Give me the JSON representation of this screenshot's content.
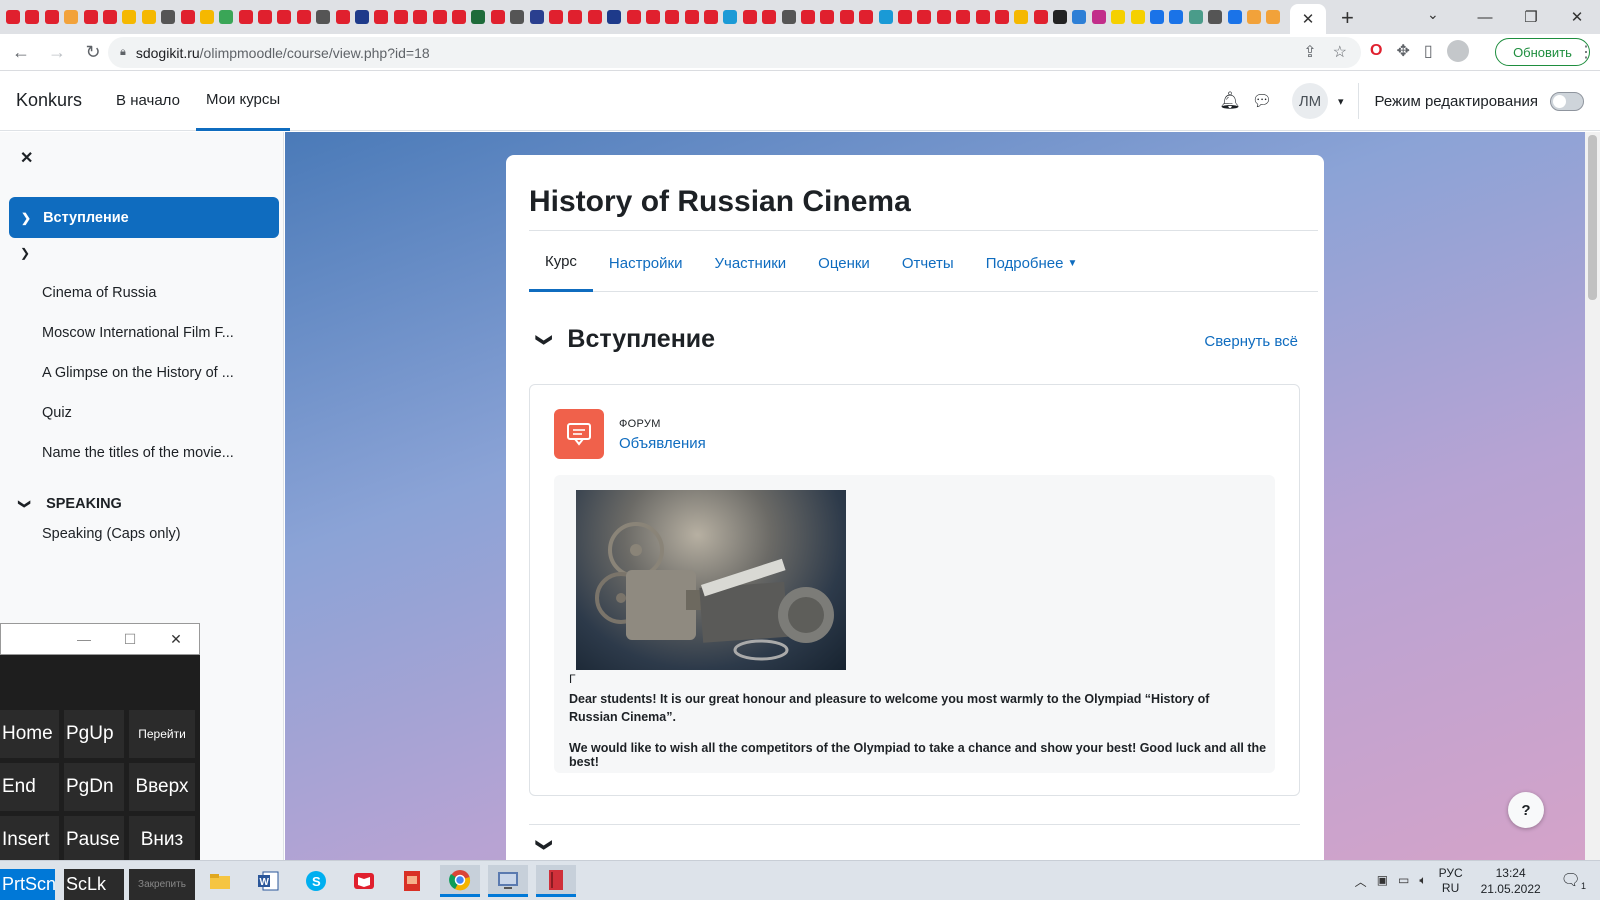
{
  "browser": {
    "url_host": "sdogikit.ru",
    "url_path": "/olimpmoodle/course/view.php?id=18",
    "update_label": "Обновить",
    "favicon_colors": [
      "#e0202e",
      "#e0202e",
      "#e0202e",
      "#f2a23a",
      "#e0202e",
      "#e0202e",
      "#f5b800",
      "#f5b800",
      "#555",
      "#e0202e",
      "#f5b800",
      "#3aa657",
      "#e0202e",
      "#e0202e",
      "#e0202e",
      "#e0202e",
      "#555",
      "#e0202e",
      "#1e3a8a",
      "#e0202e",
      "#e0202e",
      "#e0202e",
      "#e0202e",
      "#e0202e",
      "#1e6b3a",
      "#e0202e",
      "#555",
      "#2a3f8f",
      "#e0202e",
      "#e0202e",
      "#e0202e",
      "#1e3a8a",
      "#e0202e",
      "#e0202e",
      "#e0202e",
      "#e0202e",
      "#e0202e",
      "#1a9ad6",
      "#e0202e",
      "#e0202e",
      "#555",
      "#e0202e",
      "#e0202e",
      "#e0202e",
      "#e0202e",
      "#1a9ad6",
      "#e0202e",
      "#e0202e",
      "#e0202e",
      "#e0202e",
      "#e0202e",
      "#e0202e",
      "#f5b800",
      "#e0202e",
      "#222",
      "#2d7fd6",
      "#c22d8a",
      "#f5d000",
      "#f5d000",
      "#1a73e8",
      "#1a73e8",
      "#4a9c8a",
      "#555",
      "#1a73e8",
      "#f2a23a",
      "#f2a23a"
    ]
  },
  "navbar": {
    "brand": "Konkurs",
    "home": "В начало",
    "my_courses": "Мои курсы",
    "user_initials": "ЛМ",
    "edit_mode": "Режим редактирования"
  },
  "drawer": {
    "active_section": "Вступление",
    "items": [
      "Cinema of Russia",
      "Moscow International Film F...",
      "A Glimpse on the History of ...",
      "Quiz",
      "Name the titles of the movie..."
    ],
    "speaking_section": "SPEAKING",
    "speaking_item": "Speaking (Caps only)"
  },
  "course": {
    "title": "History of Russian Cinema",
    "tabs": [
      "Курс",
      "Настройки",
      "Участники",
      "Оценки",
      "Отчеты",
      "Подробнее"
    ],
    "section_title": "Вступление",
    "collapse_all": "Свернуть всё",
    "activity_type": "Форум",
    "activity_name": "Объявления",
    "stray_char": "Г",
    "paragraph1": "Dear students!  It is our great honour and pleasure to welcome you most warmly to the Olympiad “History of Russian Cinema”.",
    "paragraph2": "We would like to wish all the competitors of the Olympiad to take a chance and show your best! Good luck and all the best!",
    "help": "?"
  },
  "osk": {
    "keys": [
      "Home",
      "PgUp",
      "Перейти",
      "End",
      "PgDn",
      "Вверх",
      "Insert",
      "Pause",
      "Вниз",
      "PrtScn",
      "ScLk",
      "Закрепить"
    ]
  },
  "taskbar": {
    "lang_line1": "РУС",
    "lang_line2": "RU",
    "time": "13:24",
    "date": "21.05.2022",
    "notif_count": "1"
  }
}
